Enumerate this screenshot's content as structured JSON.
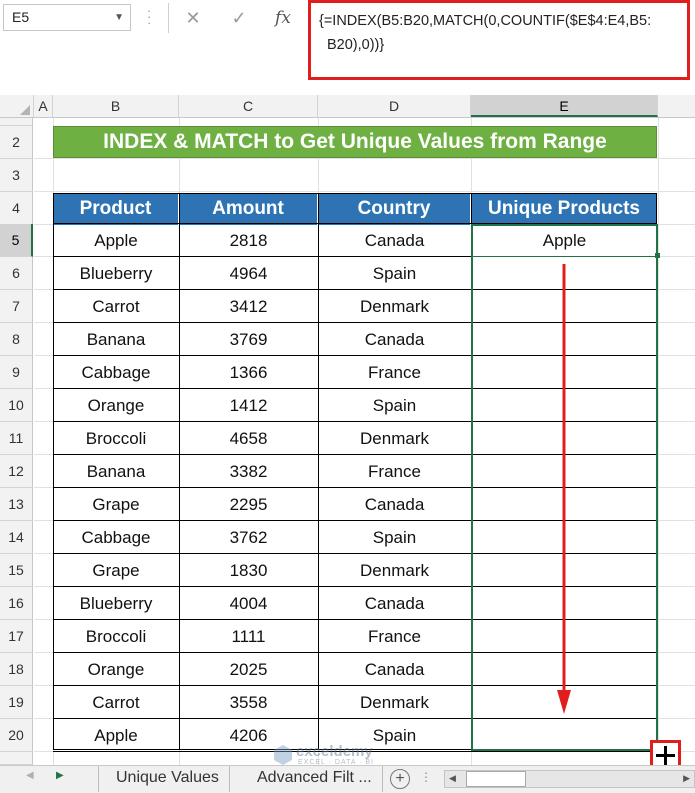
{
  "formula_bar": {
    "name_box": "E5",
    "cancel_icon": "✕",
    "enter_icon": "✓",
    "fx_label": "fx",
    "formula_line1": "{=INDEX(B5:B20,MATCH(0,COUNTIF($E$4:E4,B5:",
    "formula_line2": "B20),0))}"
  },
  "columns": [
    "A",
    "B",
    "C",
    "D",
    "E"
  ],
  "rows": [
    "2",
    "3",
    "4",
    "5",
    "6",
    "7",
    "8",
    "9",
    "10",
    "11",
    "12",
    "13",
    "14",
    "15",
    "16",
    "17",
    "18",
    "19",
    "20"
  ],
  "title": "INDEX & MATCH to Get Unique Values from Range",
  "table": {
    "headers": [
      "Product",
      "Amount",
      "Country",
      "Unique Products"
    ],
    "rows": [
      [
        "Apple",
        "2818",
        "Canada",
        "Apple"
      ],
      [
        "Blueberry",
        "4964",
        "Spain",
        ""
      ],
      [
        "Carrot",
        "3412",
        "Denmark",
        ""
      ],
      [
        "Banana",
        "3769",
        "Canada",
        ""
      ],
      [
        "Cabbage",
        "1366",
        "France",
        ""
      ],
      [
        "Orange",
        "1412",
        "Spain",
        ""
      ],
      [
        "Broccoli",
        "4658",
        "Denmark",
        ""
      ],
      [
        "Banana",
        "3382",
        "France",
        ""
      ],
      [
        "Grape",
        "2295",
        "Canada",
        ""
      ],
      [
        "Cabbage",
        "3762",
        "Spain",
        ""
      ],
      [
        "Grape",
        "1830",
        "Denmark",
        ""
      ],
      [
        "Blueberry",
        "4004",
        "Canada",
        ""
      ],
      [
        "Broccoli",
        "1111",
        "France",
        ""
      ],
      [
        "Orange",
        "2025",
        "Canada",
        ""
      ],
      [
        "Carrot",
        "3558",
        "Denmark",
        ""
      ],
      [
        "Apple",
        "4206",
        "Spain",
        ""
      ]
    ]
  },
  "watermark": {
    "brand": "exceldemy",
    "tagline": "EXCEL · DATA · BI"
  },
  "sheet_tabs": [
    "Unique Values",
    "Advanced Filt ..."
  ],
  "colors": {
    "title_fill": "#6fb043",
    "header_fill": "#2e74b5",
    "highlight_red": "#e01e1e",
    "selection_green": "#217346"
  }
}
